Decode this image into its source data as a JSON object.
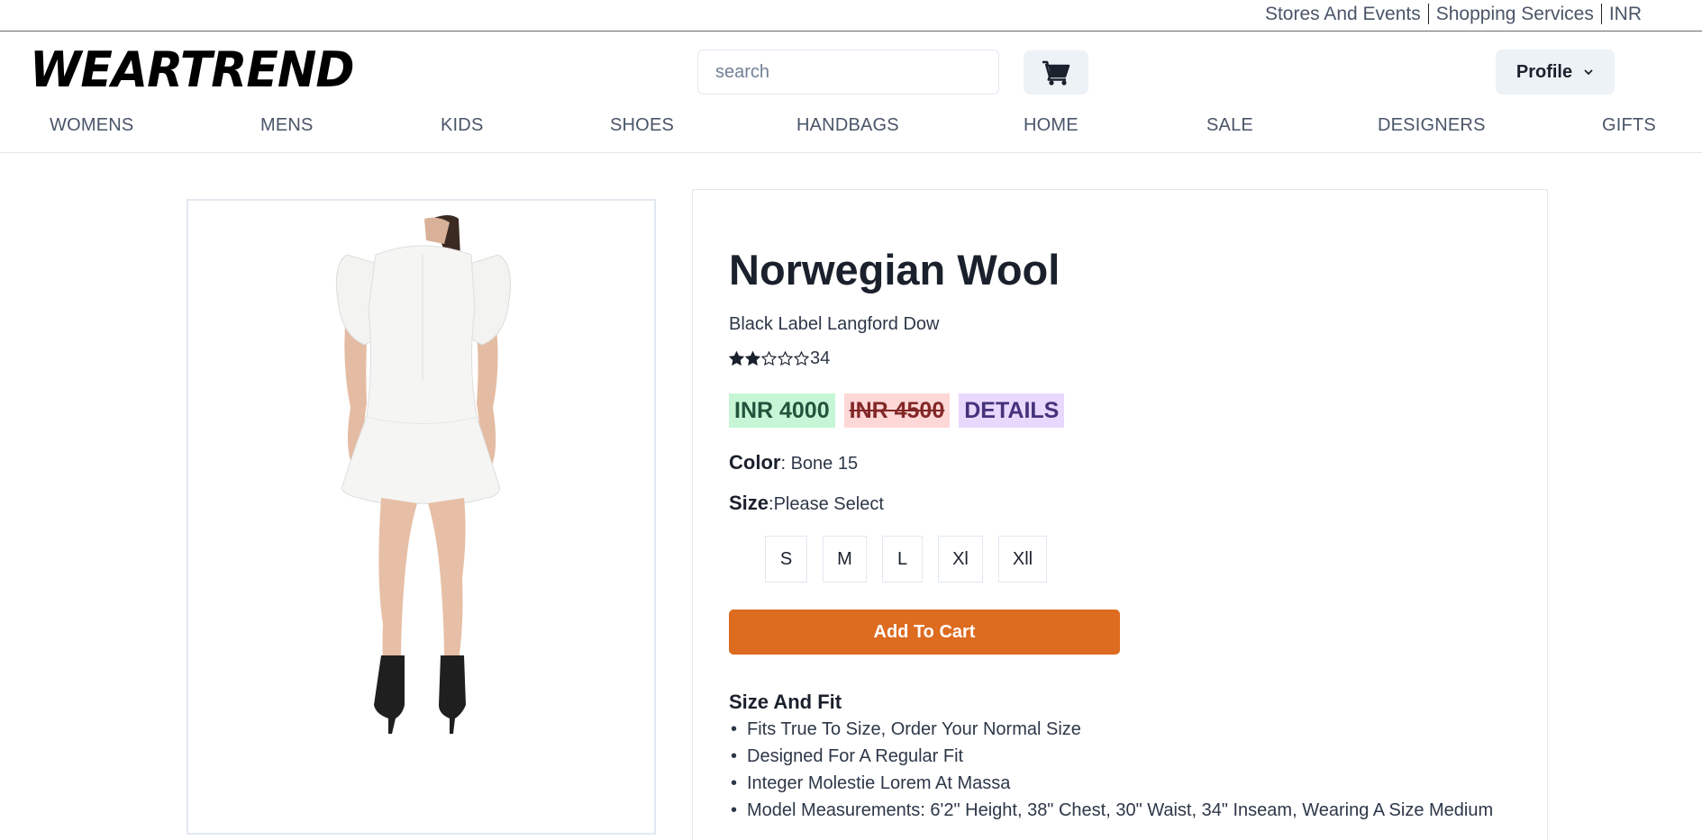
{
  "topbar": {
    "links": [
      "Stores And Events",
      "Shopping Services",
      "INR"
    ]
  },
  "header": {
    "logo": "WEARTREND",
    "search_placeholder": "search",
    "profile_label": "Profile"
  },
  "nav": {
    "items": [
      "WOMENS",
      "MENS",
      "KIDS",
      "SHOES",
      "HANDBAGS",
      "HOME",
      "SALE",
      "DESIGNERS",
      "GIFTS"
    ]
  },
  "product": {
    "title": "Norwegian Wool",
    "brand": "Black Label Langford Dow",
    "rating": 2,
    "rating_max": 5,
    "rating_count": "34",
    "price": "INR 4000",
    "old_price": "INR 4500",
    "details_label": "DETAILS",
    "color_label": "Color",
    "color_value": ": Bone 15",
    "size_label": "Size",
    "size_value": ":Please Select",
    "sizes": [
      "S",
      "M",
      "L",
      "Xl",
      "Xll"
    ],
    "add_to_cart": "Add To Cart",
    "fit_title": "Size And Fit",
    "fit_items": [
      "Fits True To Size, Order Your Normal Size",
      "Designed For A Regular Fit",
      "Integer Molestie Lorem At Massa",
      "Model Measurements: 6'2\" Height, 38\" Chest, 30\" Waist, 34\" Inseam, Wearing A Size Medium"
    ]
  },
  "colors": {
    "accent": "#dd6b20",
    "price_bg": "#c6f6d5",
    "old_price_bg": "#fed7d7",
    "details_bg": "#e9d8fd"
  },
  "icons": {
    "cart": "shopping-cart-icon",
    "profile_chevron": "chevron-down-icon",
    "star": "star-icon"
  }
}
